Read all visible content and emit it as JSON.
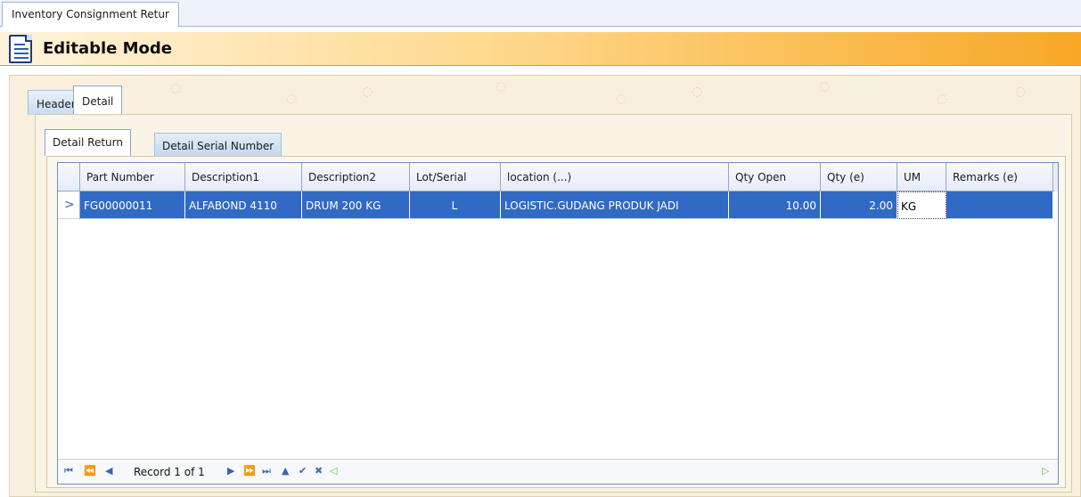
{
  "window": {
    "doc_tab": "Inventory Consignment Retur"
  },
  "banner": {
    "title": "Editable Mode"
  },
  "tabs": [
    {
      "label": "Header"
    },
    {
      "label": "Detail"
    }
  ],
  "subtabs": [
    {
      "label": "Detail Return"
    },
    {
      "label": "Detail Serial Number"
    }
  ],
  "grid": {
    "columns": [
      "Part Number",
      "Description1",
      "Description2",
      "Lot/Serial",
      "location (...)",
      "Qty Open",
      "Qty (e)",
      "UM",
      "Remarks (e)"
    ],
    "rows": [
      {
        "part_number": "FG00000011",
        "description1": "ALFABOND 4110",
        "description2": "DRUM 200 KG",
        "lot_serial": "L",
        "location": "LOGISTIC.GUDANG PRODUK JADI",
        "qty_open": "10.00",
        "qty": "2.00",
        "um": "KG",
        "remarks": ""
      }
    ],
    "row_indicator": ">"
  },
  "navigator": {
    "record_text": "Record 1 of 1"
  },
  "colors": {
    "selection": "#316ac5",
    "banner_end": "#f7a825",
    "grid_border": "#6f8fbf"
  }
}
